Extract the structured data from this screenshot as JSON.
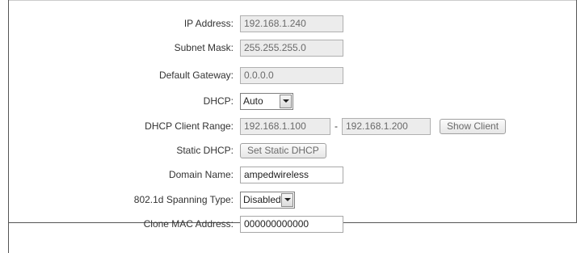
{
  "lan": {
    "ip_address": {
      "label": "IP Address:",
      "value": "192.168.1.240"
    },
    "subnet_mask": {
      "label": "Subnet Mask:",
      "value": "255.255.255.0"
    },
    "default_gateway": {
      "label": "Default Gateway:",
      "value": "0.0.0.0"
    },
    "dhcp": {
      "label": "DHCP:",
      "selected": "Auto"
    },
    "dhcp_client_range": {
      "label": "DHCP Client Range:",
      "start": "192.168.1.100",
      "separator": "-",
      "end": "192.168.1.200",
      "show_client_button": "Show Client"
    },
    "static_dhcp": {
      "label": "Static DHCP:",
      "button": "Set Static DHCP"
    },
    "domain_name": {
      "label": "Domain Name:",
      "value": "ampedwireless"
    },
    "spanning_type": {
      "label": "802.1d Spanning Type:",
      "selected": "Disabled"
    },
    "clone_mac": {
      "label": "Clone MAC Address:",
      "value": "000000000000"
    }
  }
}
